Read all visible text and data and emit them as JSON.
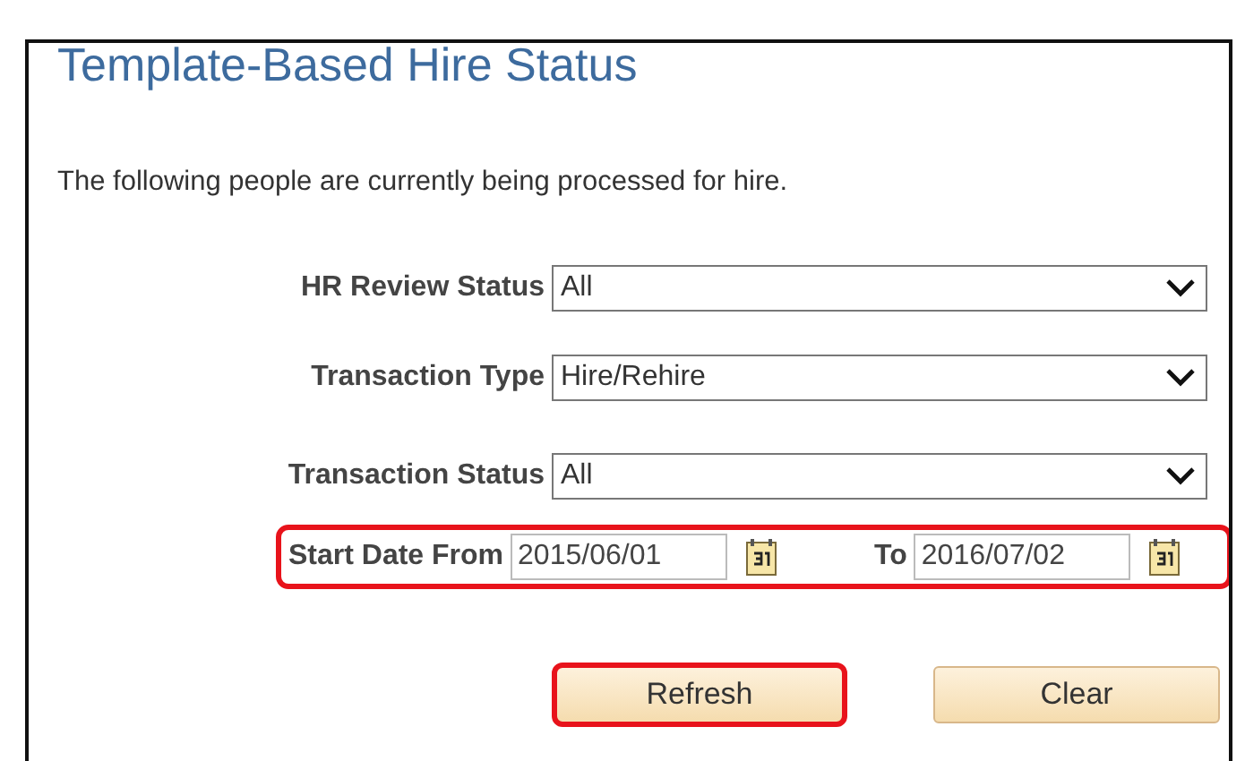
{
  "title": "Template-Based Hire Status",
  "intro": "The following people are currently being processed for hire.",
  "filters": [
    {
      "label": "HR Review Status",
      "value": "All"
    },
    {
      "label": "Transaction Type",
      "value": "Hire/Rehire"
    },
    {
      "label": "Transaction Status",
      "value": "All"
    }
  ],
  "date_range": {
    "highlighted": true,
    "from_label": "Start Date From",
    "from_value": "2015/06/01",
    "to_label": "To",
    "to_value": "2016/07/02"
  },
  "buttons": [
    {
      "label": "Refresh",
      "highlighted": true
    },
    {
      "label": "Clear",
      "highlighted": false
    }
  ]
}
